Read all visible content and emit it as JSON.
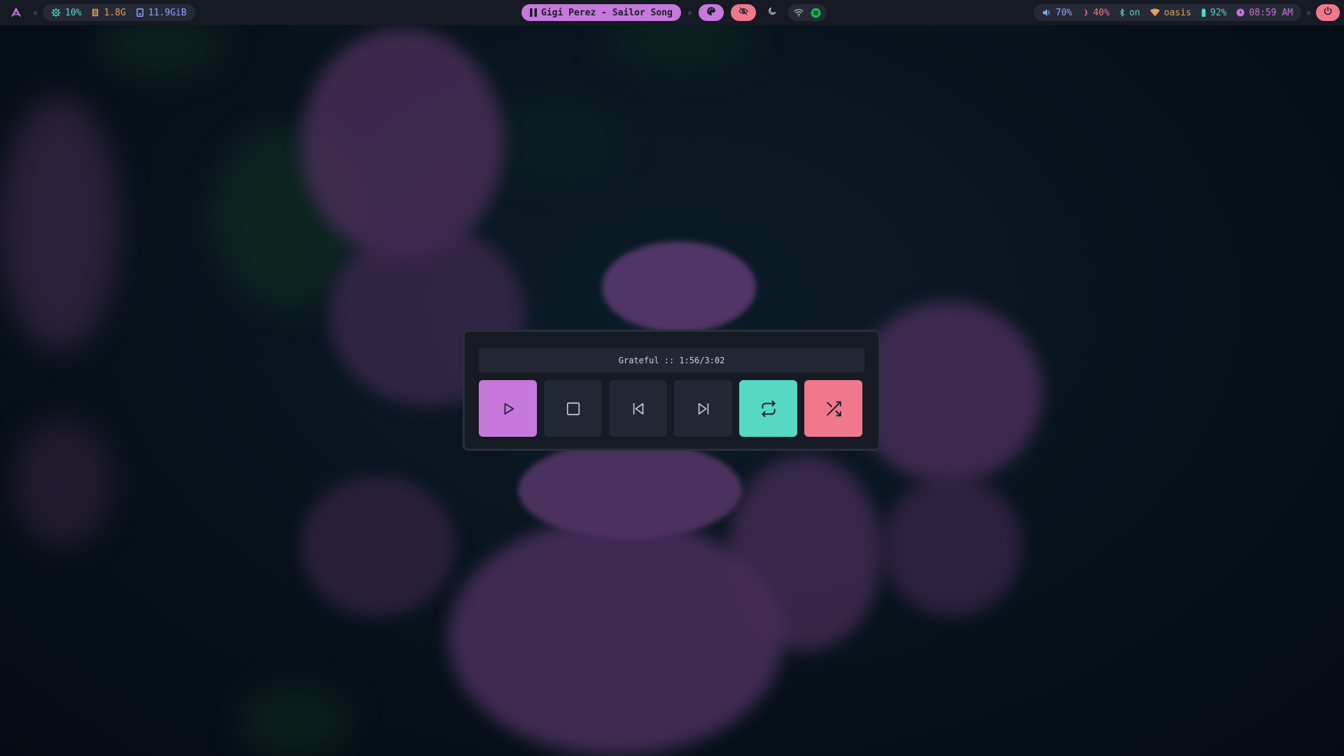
{
  "colors": {
    "bar_bg": "#161a23",
    "chip_bg": "#262a36",
    "accent_purple": "#c678dd",
    "accent_teal": "#56d8c4",
    "accent_pink": "#f0788c",
    "accent_green": "#1db954",
    "text_light": "#d0d3dd"
  },
  "topbar": {
    "launcher_icon": "arch-logo-icon",
    "system": {
      "cpu": {
        "icon": "cpu-icon",
        "value": "10%"
      },
      "memory": {
        "icon": "memory-icon",
        "value": "1.8G"
      },
      "disk": {
        "icon": "disk-icon",
        "value": "11.9GiB"
      }
    },
    "media": {
      "icon": "pause-icon",
      "title": "Gigi Perez - Sailor Song"
    },
    "center_icons": [
      "palette-icon",
      "eye-off-icon",
      "moon-icon",
      "wifi-icon",
      "spotify-icon"
    ],
    "status": {
      "volume": {
        "icon": "volume-icon",
        "value": "70%"
      },
      "brightness": {
        "icon": "moon-icon",
        "value": "40%"
      },
      "bluetooth": {
        "icon": "bluetooth-icon",
        "value": "on"
      },
      "network": {
        "icon": "wifi-icon",
        "value": "oasis"
      },
      "battery": {
        "icon": "battery-icon",
        "value": "92%"
      },
      "clock": {
        "icon": "clock-icon",
        "value": "08:59 AM"
      }
    },
    "power_icon": "power-icon"
  },
  "player": {
    "status_text": "Grateful :: 1:56/3:02",
    "buttons": [
      "play-icon",
      "stop-icon",
      "previous-icon",
      "next-icon",
      "repeat-icon",
      "shuffle-icon"
    ]
  }
}
